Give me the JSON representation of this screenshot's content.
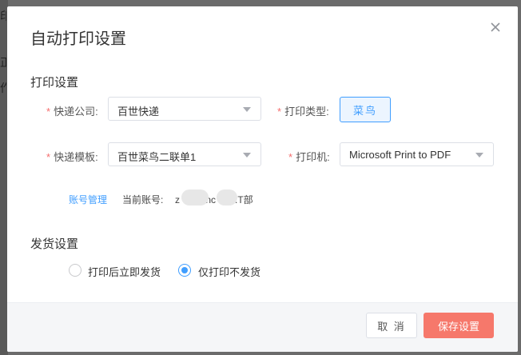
{
  "background": {
    "glyphs": [
      "印",
      "正",
      "作"
    ]
  },
  "dialog": {
    "title": "自动打印设置",
    "close_icon": "close-icon"
  },
  "print_settings": {
    "title": "打印设置",
    "courier_company": {
      "label": "快递公司:",
      "value": "百世快递"
    },
    "print_type": {
      "label": "打印类型:",
      "value": "菜鸟"
    },
    "courier_template": {
      "label": "快递模板:",
      "value": "百世菜鸟二联单1"
    },
    "printer": {
      "label": "打印机:",
      "value": "Microsoft Print to PDF"
    },
    "account_manage_link": "账号管理",
    "current_account_label": "当前账号:",
    "current_account_parts": [
      "z",
      ".nc",
      ".T部"
    ]
  },
  "shipping_settings": {
    "title": "发货设置",
    "options": [
      {
        "label": "打印后立即发货",
        "selected": false
      },
      {
        "label": "仅打印不发货",
        "selected": true
      }
    ]
  },
  "footer": {
    "cancel_label": "取 消",
    "save_label": "保存设置"
  },
  "colors": {
    "primary": "#409eff",
    "save_button": "#f6786b",
    "required_star": "#f56c6c",
    "overlay": "#6b6b6b"
  }
}
